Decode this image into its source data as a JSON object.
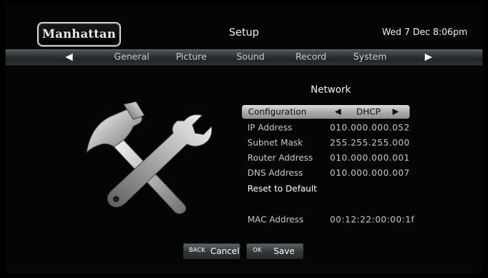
{
  "header": {
    "brand": "Manhattan",
    "title": "Setup",
    "datetime": "Wed 7 Dec 8:06pm"
  },
  "tabs": {
    "left_arrow": "◀",
    "right_arrow": "▶",
    "items": [
      "General",
      "Picture",
      "Sound",
      "Record",
      "System"
    ]
  },
  "network": {
    "title": "Network",
    "configuration": {
      "label": "Configuration",
      "value": "DHCP",
      "left_arrow": "◀",
      "right_arrow": "▶"
    },
    "rows": [
      {
        "label": "IP Address",
        "value": "010.000.000.052"
      },
      {
        "label": "Subnet Mask",
        "value": "255.255.255.000"
      },
      {
        "label": "Router Address",
        "value": "010.000.000.001"
      },
      {
        "label": "DNS Address",
        "value": "010.000.000.007"
      }
    ],
    "reset_label": "Reset to Default",
    "mac": {
      "label": "MAC Address",
      "value": "00:12:22:00:00:1f"
    }
  },
  "buttons": {
    "cancel": {
      "key": "BACK",
      "label": "Cancel"
    },
    "save": {
      "key": "OK",
      "label": "Save"
    }
  },
  "icons": {
    "illustration": "hammer-and-wrench-icon"
  }
}
